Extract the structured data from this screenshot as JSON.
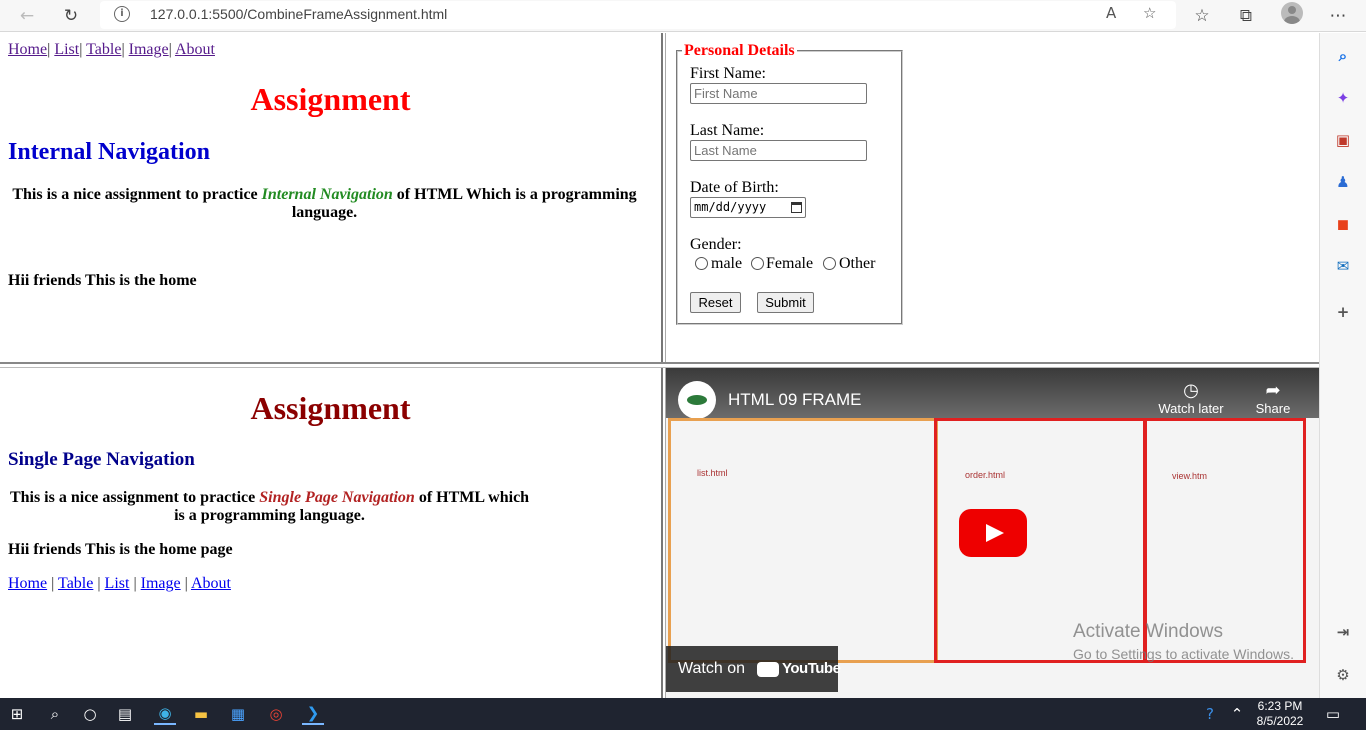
{
  "browser": {
    "url": "127.0.0.1:5500/CombineFrameAssignment.html",
    "back_icon": "back-arrow-icon",
    "refresh_icon": "refresh-icon"
  },
  "top_left": {
    "nav": [
      "Home",
      "List",
      "Table",
      "Image",
      "About"
    ],
    "heading": "Assignment",
    "subheading": "Internal Navigation",
    "para_before": "This is a nice assignment to practice ",
    "para_emph": "Internal Navigation",
    "para_after": " of HTML Which is a programming language.",
    "hello": "Hii friends This is the home"
  },
  "form": {
    "legend": "Personal Details",
    "first_label": "First Name:",
    "first_placeholder": "First Name",
    "last_label": "Last Name:",
    "last_placeholder": "Last Name",
    "dob_label": "Date of Birth:",
    "dob_value": "mm/dd/yyyy",
    "gender_label": "Gender:",
    "gender_options": [
      "male",
      "Female",
      "Other"
    ],
    "reset": "Reset",
    "submit": "Submit"
  },
  "bottom_left": {
    "heading": "Assignment",
    "subheading": "Single Page Navigation",
    "para_before": "This is a nice assignment to practice ",
    "para_emph": "Single Page Navigation",
    "para_after": " of HTML which is a programming language.",
    "hello": "Hii friends This is the home page",
    "nav": [
      "Home",
      "Table",
      "List",
      "Image",
      "About"
    ]
  },
  "video": {
    "title": "HTML 09 FRAME",
    "watch_later": "Watch later",
    "share": "Share",
    "watch_on": "Watch on",
    "youtube": "YouTube",
    "box_labels": [
      "list.html",
      "order.html",
      "view.htm"
    ],
    "activate_title": "Activate Windows",
    "activate_sub": "Go to Settings to activate Windows."
  },
  "taskbar": {
    "time": "6:23 PM",
    "date": "8/5/2022"
  },
  "colors": {
    "red": "#ff0000",
    "darkred": "#8b0000",
    "blue": "#0000cd",
    "green": "#228b22",
    "brick": "#b22222"
  }
}
